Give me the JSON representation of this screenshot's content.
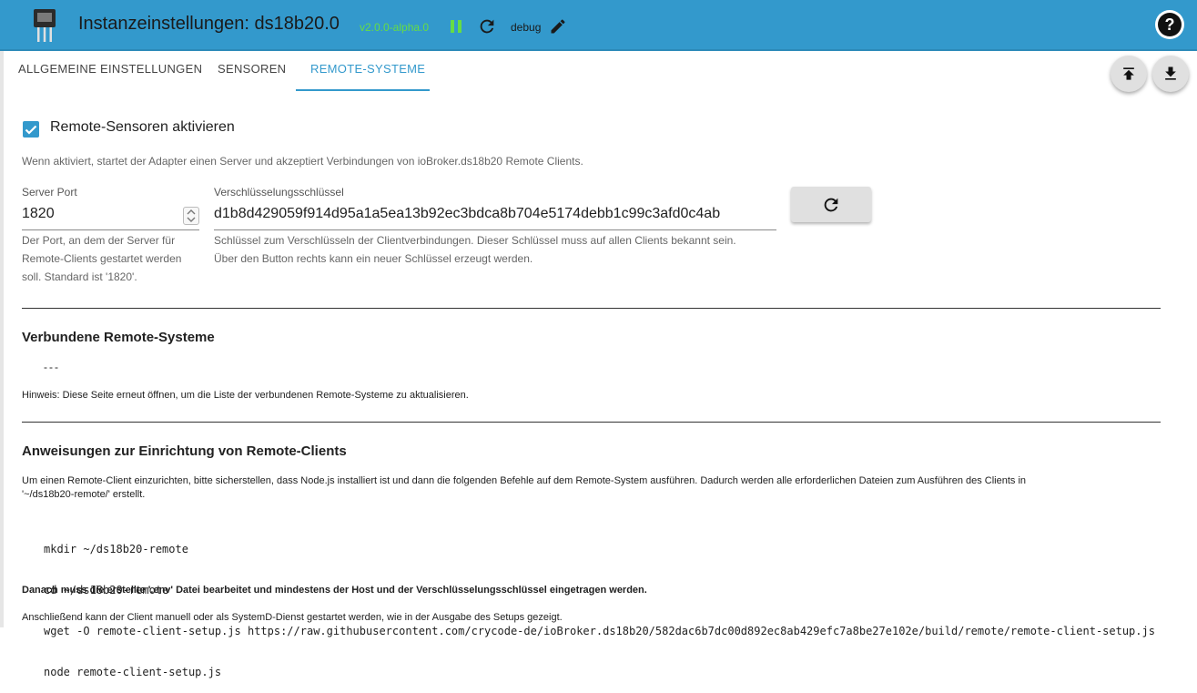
{
  "header": {
    "title": "Instanzeinstellungen: ds18b20.0",
    "version": "v2.0.0-alpha.0",
    "log_level": "debug",
    "help_label": "?"
  },
  "tabs": [
    {
      "label": "ALLGEMEINE EINSTELLUNGEN"
    },
    {
      "label": "SENSOREN"
    },
    {
      "label": "REMOTE-SYSTEME"
    }
  ],
  "active_tab": "REMOTE-SYSTEME",
  "remote": {
    "enable_label": "Remote-Sensoren aktivieren",
    "enable_checked": true,
    "enable_help": "Wenn aktiviert, startet der Adapter einen Server und akzeptiert Verbindungen von ioBroker.ds18b20 Remote Clients.",
    "port_label": "Server Port",
    "port_value": "1820",
    "port_help_1": "Der Port, an dem der Server für",
    "port_help_2": "Remote-Clients gestartet werden",
    "port_help_3": "soll. Standard ist '1820'.",
    "key_label": "Verschlüsselungsschlüssel",
    "key_value": "d1b8d429059f914d95a1a5ea13b92ec3bdca8b704e5174debb1c99c3afd0c4ab",
    "key_help_1": "Schlüssel zum Verschlüsseln der Clientverbindungen. Dieser Schlüssel muss auf allen Clients bekannt sein.",
    "key_help_2": "Über den Button rechts kann ein neuer Schlüssel erzeugt werden."
  },
  "connected": {
    "heading": "Verbundene Remote-Systeme",
    "list_placeholder": "---",
    "hint": "Hinweis: Diese Seite erneut öffnen, um die Liste der verbundenen Remote-Systeme zu aktualisieren."
  },
  "instructions": {
    "heading": "Anweisungen zur Einrichtung von Remote-Clients",
    "intro_1": "Um einen Remote-Client einzurichten, bitte sicherstellen, dass Node.js installiert ist und dann die folgenden Befehle auf dem Remote-System ausführen. Dadurch werden alle erforderlichen Dateien zum Ausführen des Clients in",
    "intro_2": "'~/ds18b20-remote/' erstellt.",
    "commands": [
      "mkdir ~/ds18b20-remote",
      "cd ~/ds18b20-remote",
      "wget -O remote-client-setup.js https://raw.githubusercontent.com/crycode-de/ioBroker.ds18b20/582dac6b7dc00d892ec8ab429efc7a8be27e102e/build/remote/remote-client-setup.js",
      "node remote-client-setup.js"
    ],
    "env_note": "Danach muss die erstellte '.env' Datei bearbeitet und mindestens der Host und der Verschlüsselungsschlüssel eingetragen werden.",
    "final_note": "Anschließend kann der Client manuell oder als SystemD-Dienst gestartet werden, wie in der Ausgabe des Setups gezeigt."
  },
  "colors": {
    "primary": "#3399cc",
    "version_green": "#66dd44"
  }
}
